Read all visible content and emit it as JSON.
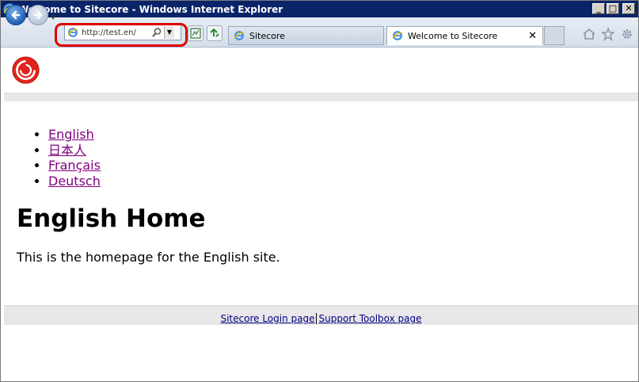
{
  "window": {
    "title": "Welcome to Sitecore - Windows Internet Explorer",
    "buttons": {
      "minimize": "_",
      "maximize": "□",
      "close": "✕"
    }
  },
  "toolbar": {
    "address_url": "http://test.en/",
    "tabs": [
      {
        "label": "Sitecore",
        "active": false
      },
      {
        "label": "Welcome to Sitecore",
        "active": true,
        "close": "✕"
      }
    ],
    "highlight_color": "#e00000"
  },
  "page": {
    "languages": [
      "English",
      "日本人",
      "Français",
      "Deutsch"
    ],
    "heading": "English Home",
    "intro": "This is the homepage for the English site.",
    "footer_links": [
      "Sitecore Login page",
      "Support Toolbox page"
    ]
  },
  "colors": {
    "link_visited": "#800080",
    "link": "#000080",
    "title_bar": "#0a246a"
  }
}
